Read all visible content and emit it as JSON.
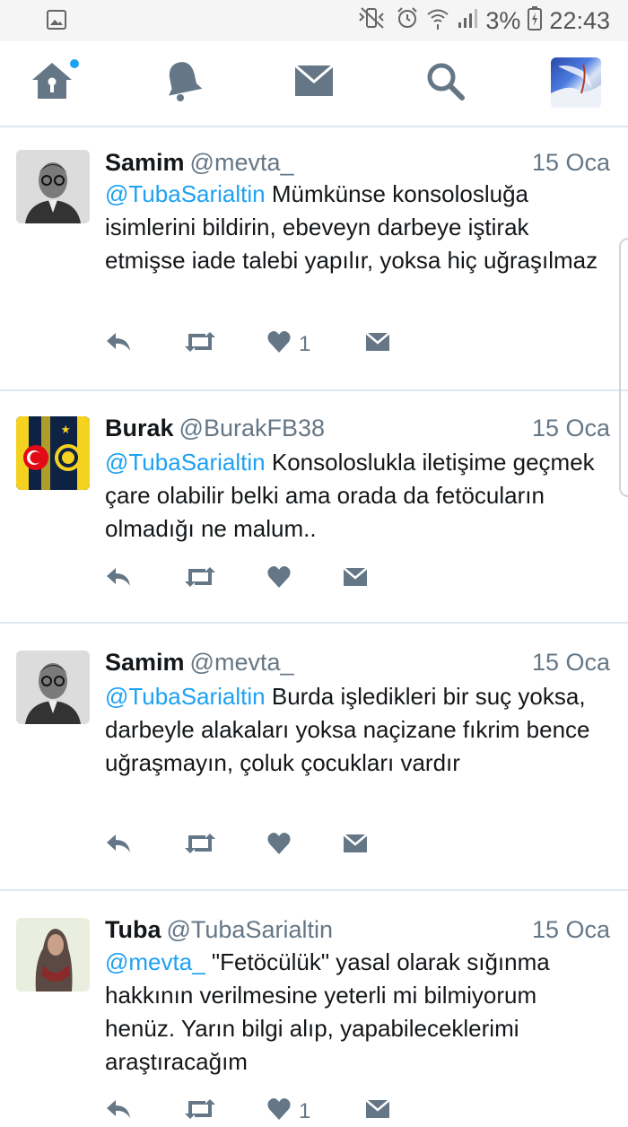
{
  "status_bar": {
    "battery_pct": "3%",
    "time": "22:43",
    "icons": [
      "image-notification-icon",
      "mute-vibrate-icon",
      "alarm-icon",
      "wifi-icon",
      "signal-icon",
      "battery-icon"
    ]
  },
  "nav": {
    "items": [
      "home-icon",
      "notifications-bell-icon",
      "messages-envelope-icon",
      "search-icon",
      "profile-avatar"
    ],
    "home_has_unread_dot": true
  },
  "colors": {
    "accent": "#1da1f2",
    "secondary_text": "#657786",
    "divider": "#e1e8ed"
  },
  "tweets": [
    {
      "name": "Samim",
      "handle": "@mevta_",
      "time": "15 Oca",
      "mention": "@TubaSarialtin",
      "text": " Mümkünse konsolosluğa isimlerini bildirin, ebeveyn darbeye iştirak etmişse iade talebi yapılır, yoksa hiç uğraşılmaz",
      "like_count": "1"
    },
    {
      "name": "Burak",
      "handle": "@BurakFB38",
      "time": "15 Oca",
      "mention": "@TubaSarialtin",
      "text": " Konsoloslukla iletişime geçmek çare olabilir belki ama orada da fetöcuların olmadığı ne malum..",
      "like_count": ""
    },
    {
      "name": "Samim",
      "handle": "@mevta_",
      "time": "15 Oca",
      "mention": "@TubaSarialtin",
      "text": " Burda işledikleri bir suç yoksa, darbeyle alakaları yoksa naçizane fıkrim bence uğraşmayın, çoluk çocukları vardır",
      "like_count": ""
    },
    {
      "name": "Tuba",
      "handle": "@TubaSarialtin",
      "time": "15 Oca",
      "mention": "@mevta_",
      "text": " \"Fetöcülük\" yasal olarak sığınma hakkının verilmesine yeterli mi bilmiyorum henüz. Yarın bilgi alıp, yapabileceklerimi araştıracağım",
      "like_count": "1"
    }
  ]
}
